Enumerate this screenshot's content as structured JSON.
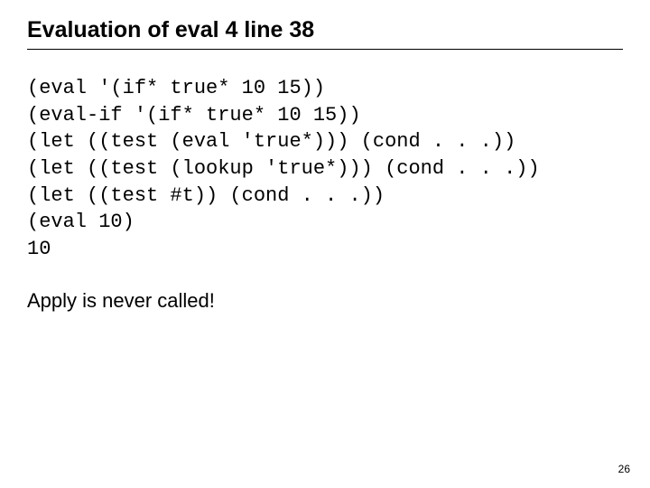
{
  "title": "Evaluation of eval 4 line 38",
  "code_lines": [
    "(eval '(if* true* 10 15))",
    "(eval-if '(if* true* 10 15))",
    "(let ((test (eval 'true*))) (cond . . .))",
    "(let ((test (lookup 'true*))) (cond . . .))",
    "(let ((test #t)) (cond . . .))",
    "(eval 10)",
    "10"
  ],
  "note": "Apply is never called!",
  "page_number": "26"
}
